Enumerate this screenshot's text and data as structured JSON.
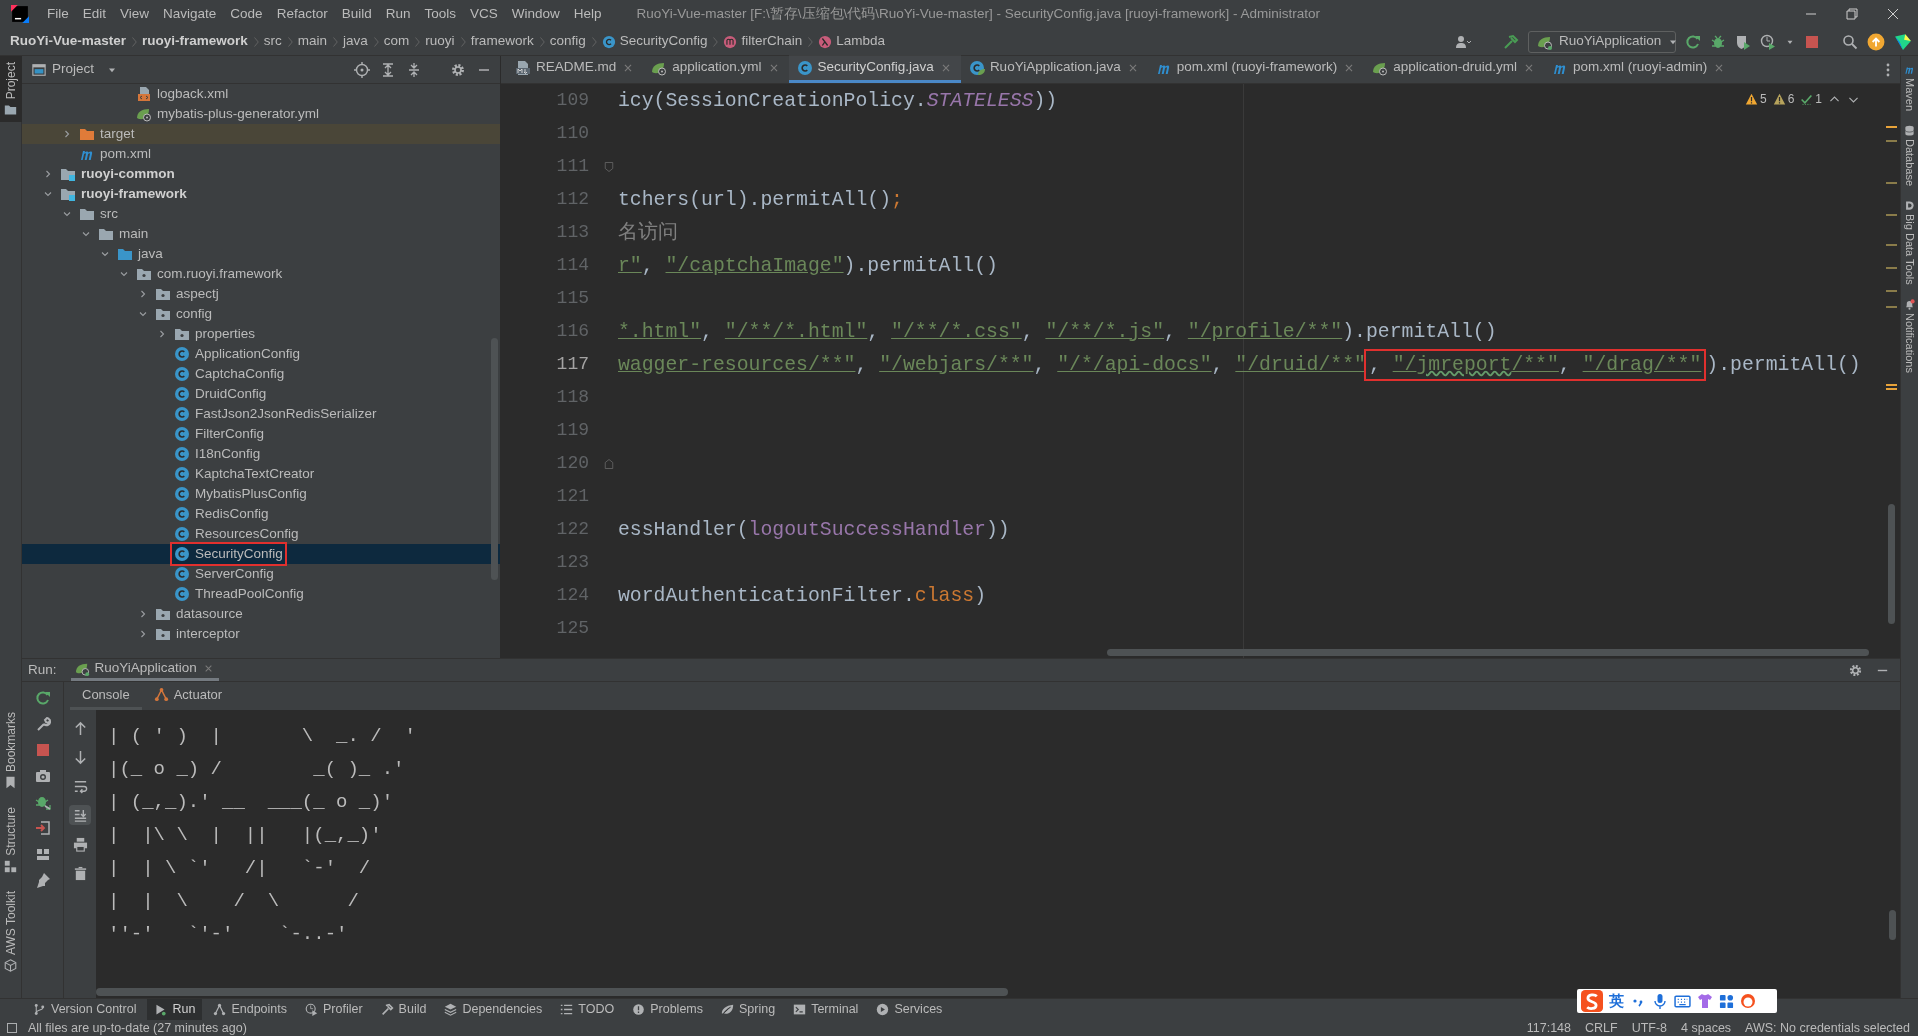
{
  "window": {
    "title": "RuoYi-Vue-master [F:\\暂存\\压缩包\\代码\\RuoYi-Vue-master] - SecurityConfig.java [ruoyi-framework] - Administrator",
    "menu": [
      "File",
      "Edit",
      "View",
      "Navigate",
      "Code",
      "Refactor",
      "Build",
      "Run",
      "Tools",
      "VCS",
      "Window",
      "Help"
    ]
  },
  "nav_bar": {
    "breadcrumbs": [
      {
        "label": "RuoYi-Vue-master",
        "kind": "project"
      },
      {
        "label": "ruoyi-framework",
        "kind": "project"
      },
      {
        "label": "src",
        "kind": "plain"
      },
      {
        "label": "main",
        "kind": "plain"
      },
      {
        "label": "java",
        "kind": "plain"
      },
      {
        "label": "com",
        "kind": "plain"
      },
      {
        "label": "ruoyi",
        "kind": "plain"
      },
      {
        "label": "framework",
        "kind": "plain"
      },
      {
        "label": "config",
        "kind": "plain"
      },
      {
        "label": "SecurityConfig",
        "kind": "class"
      },
      {
        "label": "filterChain",
        "kind": "method"
      },
      {
        "label": "Lambda",
        "kind": "lambda"
      }
    ],
    "run_config": "RuoYiApplication"
  },
  "left_stripe": {
    "top": [
      {
        "label": "Project",
        "selected": true
      }
    ],
    "bottom": [
      {
        "label": "Bookmarks",
        "selected": false
      },
      {
        "label": "Structure",
        "selected": false
      },
      {
        "label": "AWS Toolkit",
        "selected": false
      }
    ]
  },
  "right_stripe": [
    {
      "label": "Maven",
      "kind": "maven"
    },
    {
      "label": "Database",
      "kind": "database"
    },
    {
      "label": "Big Data Tools",
      "kind": "bigdata"
    },
    {
      "label": "Notifications",
      "kind": "bell"
    }
  ],
  "project_panel": {
    "title": "Project",
    "tree": [
      {
        "children": [
          {
            "children": [
              {
                "children": [
                  {
                    "children": [
                      {
                        "label": "logback.xml",
                        "kind": "xml",
                        "selected": false,
                        "boxed": false
                      },
                      {
                        "label": "mybatis-plus-generator.yml",
                        "kind": "yaml",
                        "selected": false,
                        "boxed": false
                      }
                    ]
                  }
                ]
              }
            ]
          },
          {
            "label": "target",
            "kind": "excluded-folder",
            "expanded": false,
            "selected": false,
            "boxed": false
          },
          {
            "label": "pom.xml",
            "kind": "maven",
            "selected": false,
            "boxed": false
          }
        ]
      },
      {
        "label": "ruoyi-common",
        "kind": "module",
        "expanded": false,
        "selected": false,
        "boxed": false
      },
      {
        "label": "ruoyi-framework",
        "kind": "module",
        "expanded": true,
        "selected": false,
        "boxed": false,
        "children": [
          {
            "label": "src",
            "kind": "folder",
            "expanded": true,
            "selected": false,
            "boxed": false,
            "children": [
              {
                "label": "main",
                "kind": "folder",
                "expanded": true,
                "selected": false,
                "boxed": false,
                "children": [
                  {
                    "label": "java",
                    "kind": "source-folder",
                    "expanded": true,
                    "selected": false,
                    "boxed": false,
                    "children": [
                      {
                        "label": "com.ruoyi.framework",
                        "kind": "package",
                        "expanded": true,
                        "selected": false,
                        "boxed": false,
                        "children": [
                          {
                            "label": "aspectj",
                            "kind": "package",
                            "expanded": false,
                            "selected": false,
                            "boxed": false
                          },
                          {
                            "label": "config",
                            "kind": "package",
                            "expanded": true,
                            "selected": false,
                            "boxed": false,
                            "children": [
                              {
                                "label": "properties",
                                "kind": "package",
                                "expanded": false,
                                "selected": false,
                                "boxed": false
                              },
                              {
                                "label": "ApplicationConfig",
                                "kind": "class",
                                "selected": false,
                                "boxed": false
                              },
                              {
                                "label": "CaptchaConfig",
                                "kind": "class",
                                "selected": false,
                                "boxed": false
                              },
                              {
                                "label": "DruidConfig",
                                "kind": "class",
                                "selected": false,
                                "boxed": false
                              },
                              {
                                "label": "FastJson2JsonRedisSerializer",
                                "kind": "class",
                                "selected": false,
                                "boxed": false
                              },
                              {
                                "label": "FilterConfig",
                                "kind": "class",
                                "selected": false,
                                "boxed": false
                              },
                              {
                                "label": "I18nConfig",
                                "kind": "class",
                                "selected": false,
                                "boxed": false
                              },
                              {
                                "label": "KaptchaTextCreator",
                                "kind": "class",
                                "selected": false,
                                "boxed": false
                              },
                              {
                                "label": "MybatisPlusConfig",
                                "kind": "class",
                                "selected": false,
                                "boxed": false
                              },
                              {
                                "label": "RedisConfig",
                                "kind": "class",
                                "selected": false,
                                "boxed": false
                              },
                              {
                                "label": "ResourcesConfig",
                                "kind": "class",
                                "selected": false,
                                "boxed": false
                              },
                              {
                                "label": "SecurityConfig",
                                "kind": "class",
                                "selected": true,
                                "boxed": true
                              },
                              {
                                "label": "ServerConfig",
                                "kind": "class",
                                "selected": false,
                                "boxed": false
                              },
                              {
                                "label": "ThreadPoolConfig",
                                "kind": "class",
                                "selected": false,
                                "boxed": false
                              }
                            ]
                          },
                          {
                            "label": "datasource",
                            "kind": "package",
                            "expanded": false,
                            "selected": false,
                            "boxed": false
                          },
                          {
                            "label": "interceptor",
                            "kind": "package",
                            "expanded": false,
                            "selected": false,
                            "boxed": false
                          }
                        ]
                      }
                    ]
                  }
                ]
              }
            ]
          }
        ]
      }
    ]
  },
  "editor": {
    "tabs": [
      {
        "label": "README.md",
        "kind": "md",
        "selected": false
      },
      {
        "label": "application.yml",
        "kind": "yaml",
        "selected": false
      },
      {
        "label": "SecurityConfig.java",
        "kind": "class",
        "selected": true
      },
      {
        "label": "RuoYiApplication.java",
        "kind": "spring-class",
        "selected": false
      },
      {
        "label": "pom.xml (ruoyi-framework)",
        "kind": "maven",
        "selected": false
      },
      {
        "label": "application-druid.yml",
        "kind": "yaml",
        "selected": false
      },
      {
        "label": "pom.xml (ruoyi-admin)",
        "kind": "maven",
        "selected": false
      }
    ],
    "inspections": [
      {
        "kind": "warning",
        "count": "5"
      },
      {
        "kind": "weak-warning",
        "count": "6"
      },
      {
        "kind": "ok",
        "count": "1"
      }
    ],
    "lines": [
      {
        "number": "109",
        "current": false,
        "fold": false,
        "tokens": [
          {
            "kind": "plain",
            "text": "icy(SessionCreationPolicy."
          },
          {
            "kind": "static",
            "text": "STATELESS"
          },
          {
            "kind": "plain",
            "text": "))"
          }
        ]
      },
      {
        "number": "110",
        "current": false,
        "fold": false
      },
      {
        "number": "111",
        "current": false,
        "fold": true
      },
      {
        "number": "112",
        "current": false,
        "fold": false,
        "tokens": [
          {
            "kind": "plain",
            "text": "tchers(url).permitAll()"
          },
          {
            "kind": "keyword",
            "text": ";"
          }
        ]
      },
      {
        "number": "113",
        "current": false,
        "fold": false,
        "tokens": [
          {
            "kind": "comment",
            "text": "名访问"
          }
        ]
      },
      {
        "number": "114",
        "current": false,
        "fold": false,
        "tokens": [
          {
            "kind": "string",
            "text": "r\""
          },
          {
            "kind": "plain",
            "text": ", "
          },
          {
            "kind": "string",
            "text": "\"/captchaImage\""
          },
          {
            "kind": "plain",
            "text": ").permitAll()"
          }
        ]
      },
      {
        "number": "115",
        "current": false,
        "fold": false
      },
      {
        "number": "116",
        "current": false,
        "fold": false,
        "tokens": [
          {
            "kind": "string",
            "text": "*.html\""
          },
          {
            "kind": "plain",
            "text": ", "
          },
          {
            "kind": "string",
            "text": "\"/**/*.html\""
          },
          {
            "kind": "plain",
            "text": ", "
          },
          {
            "kind": "string",
            "text": "\"/**/*.css\""
          },
          {
            "kind": "plain",
            "text": ", "
          },
          {
            "kind": "string",
            "text": "\"/**/*.js\""
          },
          {
            "kind": "plain",
            "text": ", "
          },
          {
            "kind": "string",
            "text": "\"/profile/**\""
          },
          {
            "kind": "plain",
            "text": ").permitAll()"
          }
        ]
      },
      {
        "number": "117",
        "current": true,
        "fold": false,
        "tokens": [
          {
            "kind": "string",
            "text": "wagger-resources/**\""
          },
          {
            "kind": "plain",
            "text": ", "
          },
          {
            "kind": "string",
            "text": "\"/webjars/**\""
          },
          {
            "kind": "plain",
            "text": ", "
          },
          {
            "kind": "string",
            "text": "\"/*/api-docs\""
          },
          {
            "kind": "plain",
            "text": ", "
          },
          {
            "kind": "string",
            "text": "\"/druid/**\""
          },
          {
            "kind": "boxed",
            "tokens": [
              {
                "kind": "plain",
                "text": ", "
              },
              {
                "kind": "string",
                "text": "\"/"
              },
              {
                "kind": "string-typo",
                "text": "jmreport"
              },
              {
                "kind": "string",
                "text": "/**\""
              },
              {
                "kind": "plain",
                "text": ", "
              },
              {
                "kind": "string",
                "text": "\"/drag/**\""
              }
            ]
          },
          {
            "kind": "caret"
          },
          {
            "kind": "plain",
            "text": ").permitAll()"
          }
        ]
      },
      {
        "number": "118",
        "current": false,
        "fold": false
      },
      {
        "number": "119",
        "current": false,
        "fold": false
      },
      {
        "number": "120",
        "current": false,
        "fold": true
      },
      {
        "number": "121",
        "current": false,
        "fold": false
      },
      {
        "number": "122",
        "current": false,
        "fold": false,
        "tokens": [
          {
            "kind": "plain",
            "text": "essHandler("
          },
          {
            "kind": "field",
            "text": "logoutSuccessHandler"
          },
          {
            "kind": "plain",
            "text": "))"
          }
        ]
      },
      {
        "number": "123",
        "current": false,
        "fold": false
      },
      {
        "number": "124",
        "current": false,
        "fold": false,
        "tokens": [
          {
            "kind": "plain",
            "text": "wordAuthenticationFilter."
          },
          {
            "kind": "keyword",
            "text": "class"
          },
          {
            "kind": "plain",
            "text": ")"
          }
        ]
      },
      {
        "number": "125",
        "current": false,
        "fold": false
      }
    ]
  },
  "run_panel": {
    "label": "Run:",
    "tabs": [
      {
        "label": "RuoYiApplication",
        "selected": true
      }
    ],
    "subtabs": [
      {
        "label": "Console",
        "kind": "console",
        "selected": true
      },
      {
        "label": "Actuator",
        "kind": "actuator",
        "selected": false
      }
    ],
    "console_lines": [
      "| ( ' )  |       \\  _. /  '",
      "|(_ o _) /        _( )_ .'",
      "| (_,_).' __  ___(_ o _)'",
      "|  |\\ \\  |  ||   |(_,_)'",
      "|  | \\ `'   /|   `-'  /",
      "|  |  \\    /  \\      /",
      "''-'   `'-'    `-..-'"
    ]
  },
  "tool_tabs": [
    {
      "label": "Version Control",
      "kind": "vcs",
      "selected": false
    },
    {
      "label": "Run",
      "kind": "run",
      "selected": true
    },
    {
      "label": "Endpoints",
      "kind": "endpoints",
      "selected": false
    },
    {
      "label": "Profiler",
      "kind": "profiler",
      "selected": false
    },
    {
      "label": "Build",
      "kind": "build",
      "selected": false
    },
    {
      "label": "Dependencies",
      "kind": "dependencies",
      "selected": false
    },
    {
      "label": "TODO",
      "kind": "todo",
      "selected": false
    },
    {
      "label": "Problems",
      "kind": "problems",
      "selected": false
    },
    {
      "label": "Spring",
      "kind": "spring",
      "selected": false
    },
    {
      "label": "Terminal",
      "kind": "terminal",
      "selected": false
    },
    {
      "label": "Services",
      "kind": "services",
      "selected": false
    }
  ],
  "status_bar": {
    "message": "All files are up-to-date (27 minutes ago)",
    "items": [
      "117:148",
      "CRLF",
      "UTF-8",
      "4 spaces",
      "AWS: No credentials selected"
    ]
  },
  "ime_toolbar": {
    "mode": "英"
  }
}
